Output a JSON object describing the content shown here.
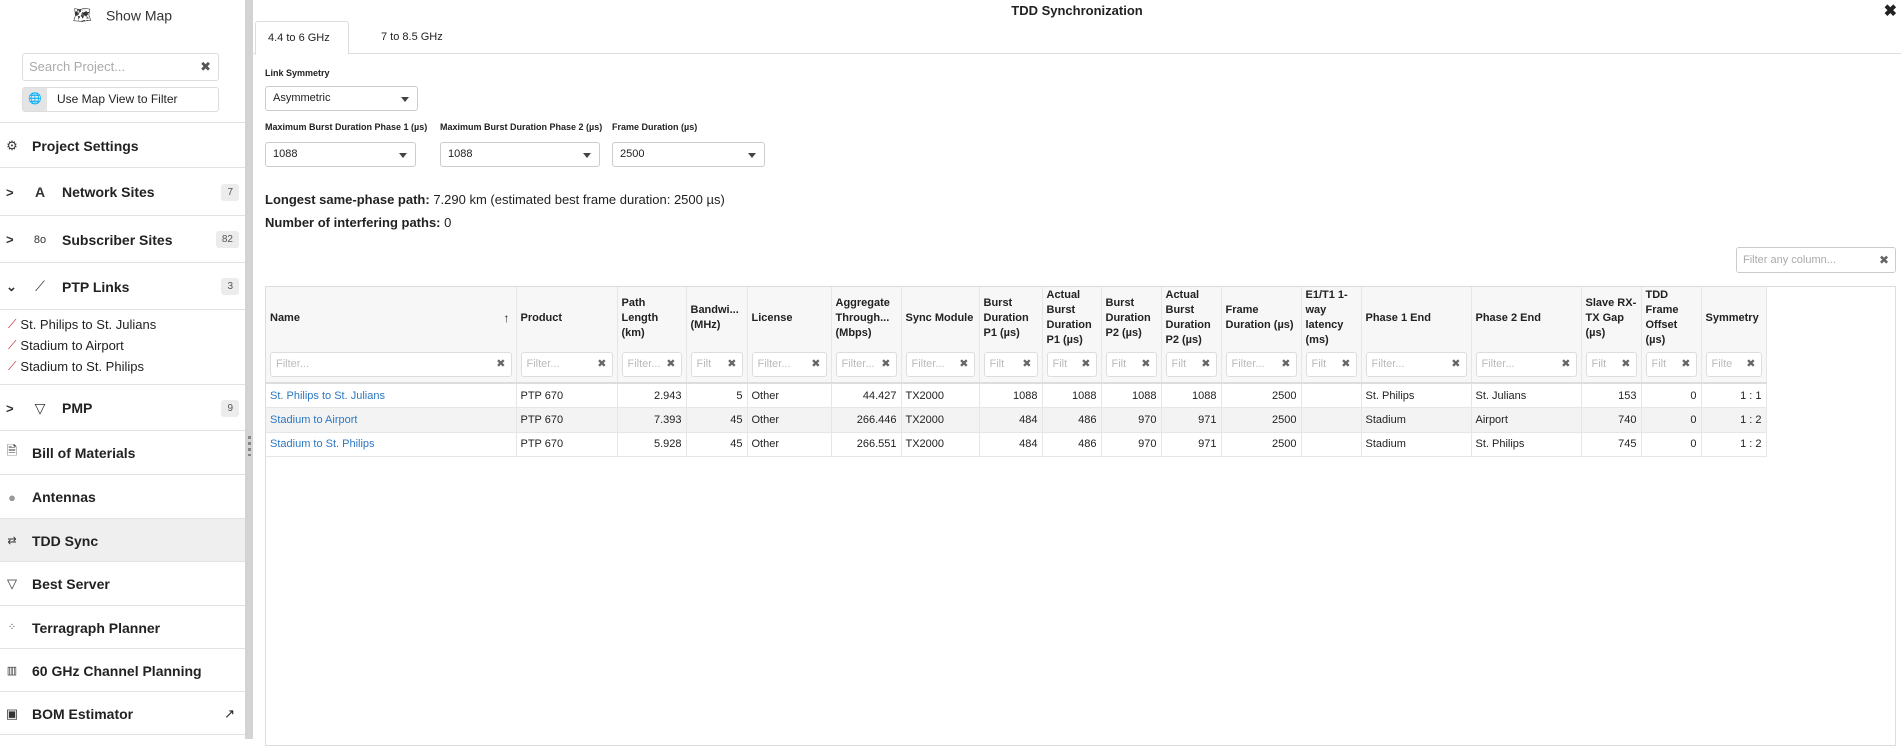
{
  "sidebar": {
    "show_map": "Show Map",
    "search_placeholder": "Search Project...",
    "map_filter": "Use Map View to Filter",
    "project_settings": "Project Settings",
    "network_sites": {
      "label": "Network Sites",
      "count": "7"
    },
    "subscriber_sites": {
      "label": "Subscriber Sites",
      "count": "82"
    },
    "ptp_links": {
      "label": "PTP Links",
      "count": "3",
      "items": [
        "St. Philips to St. Julians",
        "Stadium to Airport",
        "Stadium to St. Philips"
      ]
    },
    "pmp": {
      "label": "PMP",
      "count": "9"
    },
    "items": [
      "Bill of Materials",
      "Antennas",
      "TDD Sync",
      "Best Server",
      "Terragraph Planner",
      "60 GHz Channel Planning",
      "BOM Estimator"
    ],
    "active": "TDD Sync"
  },
  "main": {
    "title": "TDD Synchronization",
    "tabs": [
      "4.4 to 6 GHz",
      "7 to 8.5 GHz"
    ],
    "active_tab": "4.4 to 6 GHz",
    "link_symmetry": {
      "label": "Link Symmetry",
      "value": "Asymmetric"
    },
    "burst_p1": {
      "label": "Maximum Burst Duration Phase 1 (µs)",
      "value": "1088"
    },
    "burst_p2": {
      "label": "Maximum Burst Duration Phase 2 (µs)",
      "value": "1088"
    },
    "frame": {
      "label": "Frame Duration (µs)",
      "value": "2500"
    },
    "longest_label": "Longest same-phase path:",
    "longest_value": "7.290 km (estimated best frame duration: 2500 µs)",
    "interfering_label": "Number of interfering paths:",
    "interfering_value": "0",
    "filter_any_placeholder": "Filter any column..."
  },
  "table": {
    "columns": [
      {
        "label": "Name",
        "filter": "Filter...",
        "align": "left",
        "sorted": "asc"
      },
      {
        "label": "Product",
        "filter": "Filter...",
        "align": "left"
      },
      {
        "label": "Path Length (km)",
        "filter": "Filter...",
        "align": "right"
      },
      {
        "label": "Bandwi... (MHz)",
        "filter": "Filt",
        "align": "right"
      },
      {
        "label": "License",
        "filter": "Filter...",
        "align": "left"
      },
      {
        "label": "Aggregate Through... (Mbps)",
        "filter": "Filter...",
        "align": "right"
      },
      {
        "label": "Sync Module",
        "filter": "Filter...",
        "align": "left"
      },
      {
        "label": "Burst Duration P1 (µs)",
        "filter": "Filt",
        "align": "right"
      },
      {
        "label": "Actual Burst Duration P1 (µs)",
        "filter": "Filt",
        "align": "right"
      },
      {
        "label": "Burst Duration P2 (µs)",
        "filter": "Filt",
        "align": "right"
      },
      {
        "label": "Actual Burst Duration P2 (µs)",
        "filter": "Filt",
        "align": "right"
      },
      {
        "label": "Frame Duration (µs)",
        "filter": "Filter...",
        "align": "right"
      },
      {
        "label": "E1/T1 1-way latency (ms)",
        "filter": "Filt",
        "align": "right"
      },
      {
        "label": "Phase 1 End",
        "filter": "Filter...",
        "align": "left"
      },
      {
        "label": "Phase 2 End",
        "filter": "Filter...",
        "align": "left"
      },
      {
        "label": "Slave RX-TX Gap (µs)",
        "filter": "Filt",
        "align": "right"
      },
      {
        "label": "TDD Frame Offset (µs)",
        "filter": "Filt",
        "align": "right"
      },
      {
        "label": "Symmetry",
        "filter": "Filte",
        "align": "right"
      }
    ],
    "rows": [
      [
        "St. Philips to St. Julians",
        "PTP 670",
        "2.943",
        "5",
        "Other",
        "44.427",
        "TX2000",
        "1088",
        "1088",
        "1088",
        "1088",
        "2500",
        "",
        "St. Philips",
        "St. Julians",
        "153",
        "0",
        "1 : 1"
      ],
      [
        "Stadium to Airport",
        "PTP 670",
        "7.393",
        "45",
        "Other",
        "266.446",
        "TX2000",
        "484",
        "486",
        "970",
        "971",
        "2500",
        "",
        "Stadium",
        "Airport",
        "740",
        "0",
        "1 : 2"
      ],
      [
        "Stadium to St. Philips",
        "PTP 670",
        "5.928",
        "45",
        "Other",
        "266.551",
        "TX2000",
        "484",
        "486",
        "970",
        "971",
        "2500",
        "",
        "Stadium",
        "St. Philips",
        "745",
        "0",
        "1 : 2"
      ]
    ]
  },
  "colors": {
    "link": "#2b78c2",
    "active_row": "#efefef",
    "ptp_icon": "#c0282d"
  }
}
